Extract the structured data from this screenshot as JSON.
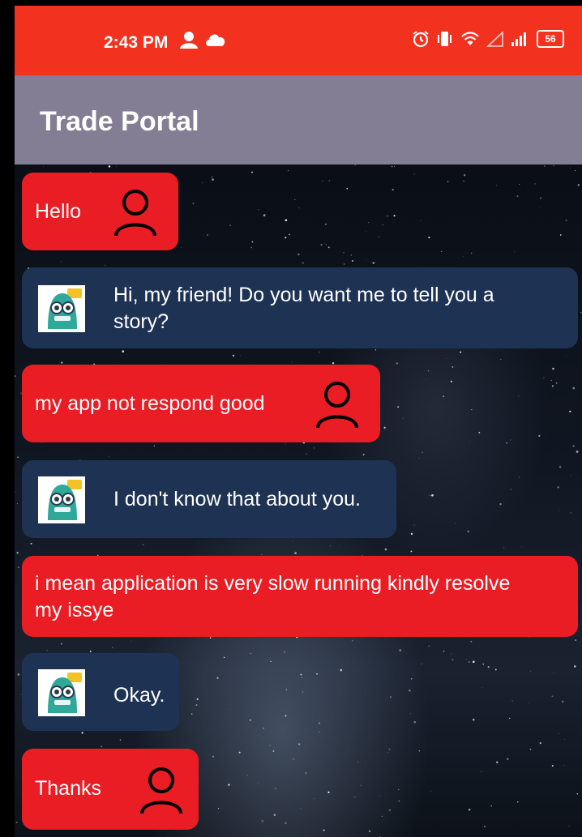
{
  "status_bar": {
    "time": "2:43 PM",
    "battery": "56",
    "left_icons": [
      "profile-notification-icon",
      "cloud-icon"
    ],
    "right_icons": [
      "alarm-icon",
      "vibrate-icon",
      "wifi-icon",
      "signal-empty-icon",
      "signal-icon",
      "battery-icon"
    ]
  },
  "app_bar": {
    "title": "Trade Portal"
  },
  "colors": {
    "status_bar": "#f2311f",
    "app_bar": "#837e93",
    "user_bubble": "#ea1c24",
    "bot_bubble": "#1e3253"
  },
  "messages": [
    {
      "sender": "user",
      "text": "Hello"
    },
    {
      "sender": "bot",
      "text_lines": [
        "Hi, my friend! Do you want me to tell you a",
        "story?"
      ]
    },
    {
      "sender": "user",
      "text": "my app not respond good"
    },
    {
      "sender": "bot",
      "text": "I don't know that about you."
    },
    {
      "sender": "user",
      "text_lines": [
        "i mean application is very slow running kindly resolve",
        "my issye"
      ]
    },
    {
      "sender": "bot",
      "text": "Okay."
    },
    {
      "sender": "user",
      "text": "Thanks"
    }
  ]
}
